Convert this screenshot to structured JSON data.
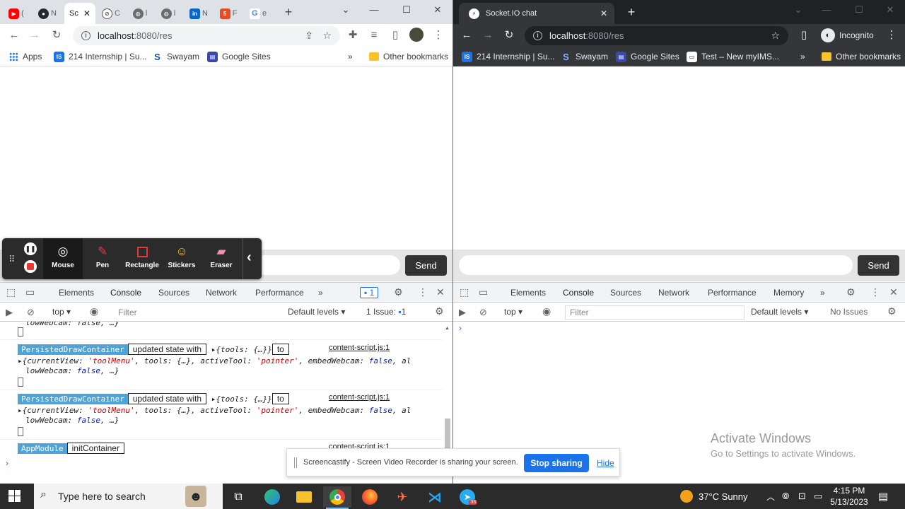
{
  "left": {
    "tabs": [
      {
        "label": "(",
        "icon": "youtube-icon",
        "color": "#ff0000"
      },
      {
        "label": "N",
        "icon": "github-icon",
        "color": "#24292f"
      },
      {
        "label": "Sc",
        "icon": "socketio-icon",
        "color": "#202124"
      },
      {
        "label": "C",
        "icon": "openai-icon",
        "color": "#10a37f"
      },
      {
        "label": "l",
        "icon": "web-icon",
        "color": "#5f6368"
      },
      {
        "label": "l",
        "icon": "web-icon",
        "color": "#5f6368"
      },
      {
        "label": "N",
        "icon": "linkedin-icon",
        "color": "#0a66c2"
      },
      {
        "label": "F",
        "icon": "html5-icon",
        "color": "#e44d26"
      },
      {
        "label": "e",
        "icon": "google-icon",
        "color": "#4285f4"
      }
    ],
    "omnibox": {
      "host": "localhost",
      "path": ":8080/res"
    },
    "bookmarks": {
      "apps": "Apps",
      "items": [
        "214 Internship | Su...",
        "Swayam",
        "Google Sites"
      ],
      "more": "»",
      "other": "Other bookmarks"
    },
    "chat": {
      "send": "Send"
    },
    "devtools": {
      "tabs": [
        "Elements",
        "Console",
        "Sources",
        "Network",
        "Performance"
      ],
      "more": "»",
      "issues_badge": "1",
      "context": "top",
      "filter_placeholder": "Filter",
      "levels": "Default levels",
      "issues": "1 Issue:",
      "issues_count": "1"
    },
    "console": {
      "top_fragment": "lowWebcam: false, …}",
      "entries": [
        {
          "tag": "PersistedDrawContainer",
          "msg": "updated state with",
          "obj": "{tools: {…}}",
          "to": "to",
          "src": "content-script.js:1",
          "line1_a": "{currentView: ",
          "line1_b": "'toolMenu'",
          "line1_c": ", tools: {…}, activeTool: ",
          "line1_d": "'pointer'",
          "line1_e": ", embedWebcam: ",
          "line1_f": "false",
          "line1_g": ", al",
          "line2_a": "lowWebcam: ",
          "line2_b": "false",
          "line2_c": ", …}"
        },
        {
          "tag": "PersistedDrawContainer",
          "msg": "updated state with",
          "obj": "{tools: {…}}",
          "to": "to",
          "src": "content-script.js:1",
          "line1_a": "{currentView: ",
          "line1_b": "'toolMenu'",
          "line1_c": ", tools: {…}, activeTool: ",
          "line1_d": "'pointer'",
          "line1_e": ", embedWebcam: ",
          "line1_f": "false",
          "line1_g": ", al",
          "line2_a": "lowWebcam: ",
          "line2_b": "false",
          "line2_c": ", …}"
        }
      ],
      "last": {
        "tag": "AppModule",
        "msg": "initContainer",
        "src": "content-script.js:1"
      },
      "prompt": "›"
    }
  },
  "right": {
    "tab": {
      "label": "Socket.IO chat",
      "icon": "socketio-icon"
    },
    "omnibox": {
      "host": "localhost",
      "path": ":8080/res"
    },
    "profile": "Incognito",
    "bookmarks": {
      "items": [
        "214 Internship | Su...",
        "Swayam",
        "Google Sites",
        "Test – New myIMS..."
      ],
      "more": "»",
      "other": "Other bookmarks"
    },
    "chat": {
      "send": "Send"
    },
    "devtools": {
      "tabs": [
        "Elements",
        "Console",
        "Sources",
        "Network",
        "Performance",
        "Memory"
      ],
      "more": "»",
      "context": "top",
      "filter_placeholder": "Filter",
      "levels": "Default levels",
      "issues": "No Issues"
    },
    "console": {
      "prompt": "›"
    }
  },
  "screencastify": {
    "tools": [
      {
        "label": "Mouse",
        "icon": "cursor-icon"
      },
      {
        "label": "Pen",
        "icon": "pen-icon"
      },
      {
        "label": "Rectangle",
        "icon": "rectangle-icon"
      },
      {
        "label": "Stickers",
        "icon": "sticker-icon"
      },
      {
        "label": "Eraser",
        "icon": "eraser-icon"
      }
    ],
    "collapse": "‹"
  },
  "sharing": {
    "message": "Screencastify - Screen Video Recorder is sharing your screen.",
    "stop": "Stop sharing",
    "hide": "Hide"
  },
  "activate": {
    "title": "Activate Windows",
    "subtitle": "Go to Settings to activate Windows."
  },
  "taskbar": {
    "search_placeholder": "Type here to search",
    "weather": "37°C  Sunny",
    "time": "4:15 PM",
    "date": "5/13/2023",
    "telegram_badge": "33"
  }
}
